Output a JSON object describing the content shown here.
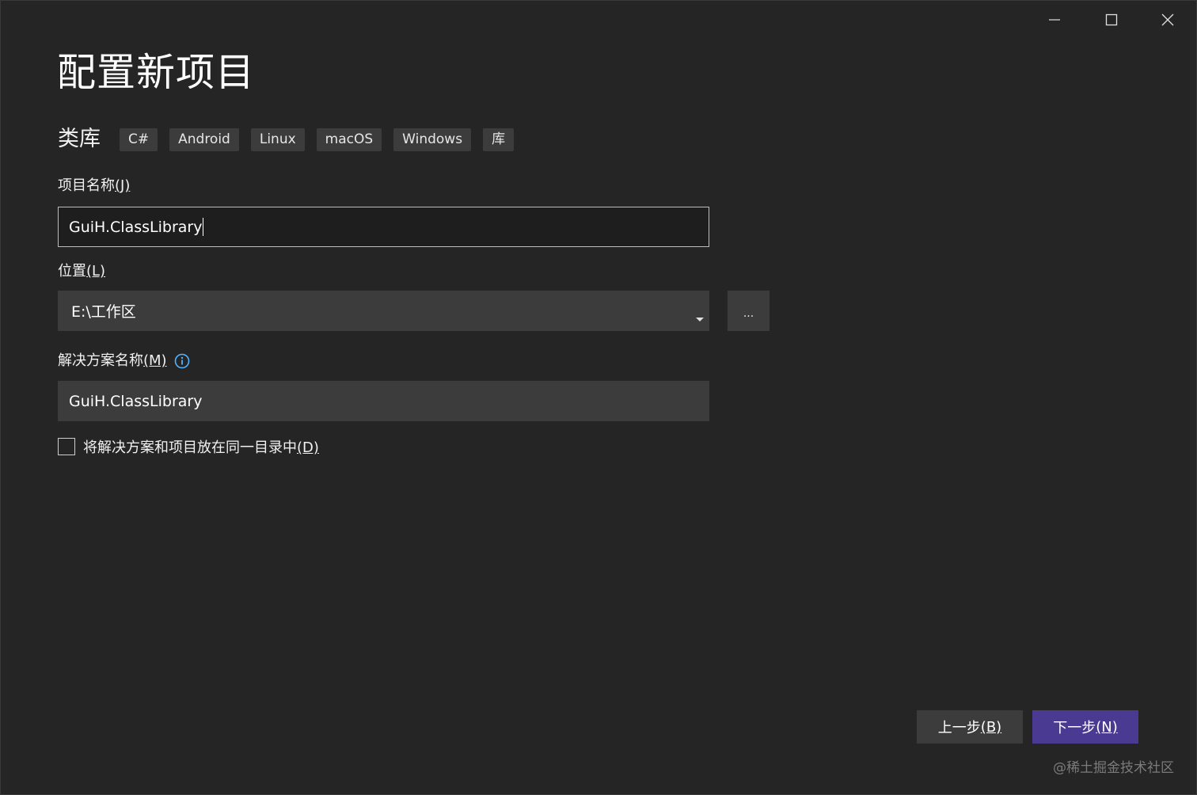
{
  "window": {
    "controls": {
      "minimize_icon": "minimize-icon",
      "maximize_icon": "maximize-icon",
      "close_icon": "close-icon"
    }
  },
  "page_title": "配置新项目",
  "template": {
    "name": "类库",
    "tags": [
      "C#",
      "Android",
      "Linux",
      "macOS",
      "Windows",
      "库"
    ]
  },
  "project_name": {
    "label": "项目名称",
    "label_key": "(J)",
    "value": "GuiH.ClassLibrary"
  },
  "location": {
    "label": "位置",
    "label_key": "(L)",
    "value": "E:\\工作区",
    "browse_label": "..."
  },
  "solution_name": {
    "label": "解决方案名称",
    "label_key": "(M)",
    "value": "GuiH.ClassLibrary",
    "info_icon": "info-icon"
  },
  "same_directory": {
    "label": "将解决方案和项目放在同一目录中",
    "label_key": "(D)",
    "checked": false
  },
  "footer": {
    "back_label": "上一步",
    "back_key": "(B)",
    "next_label": "下一步",
    "next_key": "(N)"
  },
  "watermark": "@稀土掘金技术社区",
  "colors": {
    "background": "#252526",
    "input_background": "#3c3c3c",
    "primary_button": "#4b3a92",
    "info_icon": "#4fb3ff"
  }
}
